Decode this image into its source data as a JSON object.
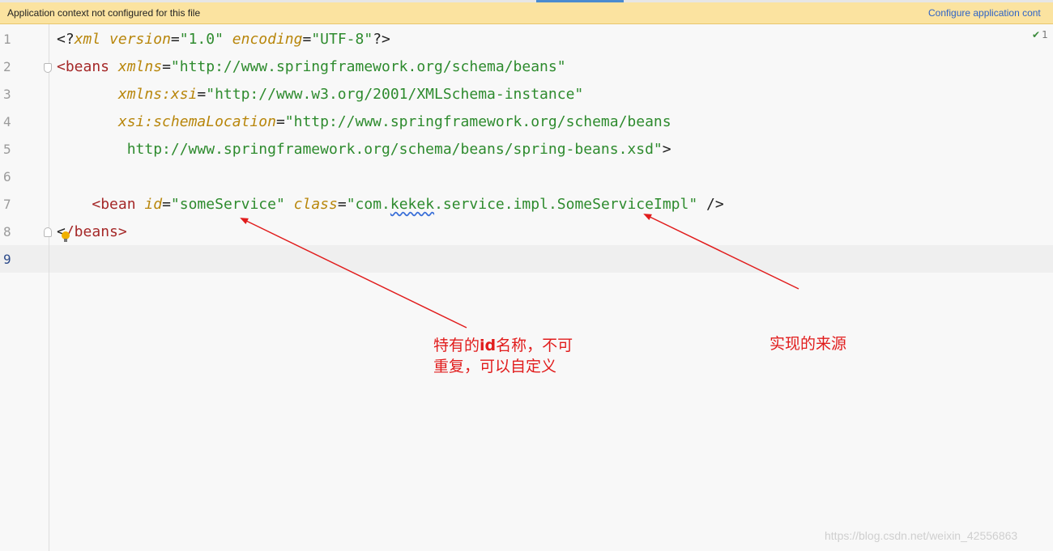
{
  "banner": {
    "message": "Application context not configured for this file",
    "action": "Configure application cont"
  },
  "inspection": {
    "icon": "checkmark-icon",
    "count": "1"
  },
  "lines": [
    {
      "n": "1"
    },
    {
      "n": "2"
    },
    {
      "n": "3"
    },
    {
      "n": "4"
    },
    {
      "n": "5"
    },
    {
      "n": "6"
    },
    {
      "n": "7"
    },
    {
      "n": "8"
    },
    {
      "n": "9"
    }
  ],
  "code": {
    "l1": {
      "open": "<?",
      "xml": "xml",
      "sp1": " ",
      "ver": "version",
      "eq1": "=",
      "verv": "\"1.0\"",
      "sp2": " ",
      "enc": "encoding",
      "eq2": "=",
      "encv": "\"UTF-8\"",
      "close": "?>"
    },
    "l2": {
      "open": "<beans",
      "sp": " ",
      "ns": "xmlns",
      "eq": "=",
      "val": "\"http://www.springframework.org/schema/beans\""
    },
    "l3": {
      "ind": "       ",
      "ns1": "xmlns",
      "col": ":",
      "ns2": "xsi",
      "eq": "=",
      "val": "\"http://www.w3.org/2001/XMLSchema-instance\""
    },
    "l4": {
      "ind": "       ",
      "ns1": "xsi",
      "col": ":",
      "ns2": "schemaLocation",
      "eq": "=",
      "val": "\"http://www.springframework.org/schema/beans"
    },
    "l5": {
      "ind": "        ",
      "val": "http://www.springframework.org/schema/beans/spring-beans.xsd\"",
      "close": ">"
    },
    "l7": {
      "ind": "    ",
      "open": "<bean",
      "sp1": " ",
      "id": "id",
      "eq1": "=",
      "idv": "\"someService\"",
      "sp2": " ",
      "cls": "class",
      "eq2": "=",
      "q": "\"com.",
      "kekek": "kekek",
      ".rest": ".service.impl.SomeServiceImpl\"",
      "sp3": " ",
      "close": "/>"
    },
    "l8": {
      "lt": "<",
      "close": "/beans>"
    }
  },
  "annotations": {
    "left_line1_pre": "特有的",
    "left_line1_bold": "id",
    "left_line1_post": "名称，不可",
    "left_line2": "重复，可以自定义",
    "right": "实现的来源",
    "color": "#e11c1c"
  },
  "watermark": "https://blog.csdn.net/weixin_42556863"
}
